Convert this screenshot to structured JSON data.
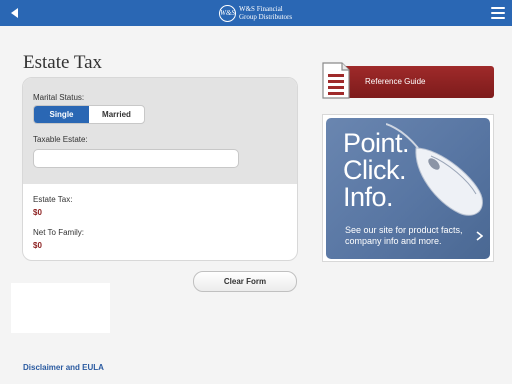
{
  "header": {
    "brand_mark": "W&S",
    "brand_line1": "W&S Financial",
    "brand_line2": "Group Distributors"
  },
  "page": {
    "title": "Estate Tax"
  },
  "form": {
    "marital_status_label": "Marital Status:",
    "marital_options": [
      "Single",
      "Married"
    ],
    "selected_marital": "Single",
    "taxable_estate_label": "Taxable Estate:",
    "taxable_estate_value": "",
    "estate_tax_label": "Estate Tax:",
    "estate_tax_value": "$0",
    "net_to_family_label": "Net To Family:",
    "net_to_family_value": "$0"
  },
  "actions": {
    "clear_label": "Clear Form"
  },
  "footer": {
    "disclaimer_label": "Disclaimer and EULA"
  },
  "sidebar": {
    "reference_guide_label": "Reference Guide",
    "promo_line1": "Point.",
    "promo_line2": "Click.",
    "promo_line3": "Info.",
    "promo_sub": "See our site for product facts, company info and more."
  },
  "colors": {
    "header_bg": "#2a67b4",
    "accent_red": "#8b1e1e",
    "link_blue": "#2a5aa0"
  },
  "icons": [
    "back-icon",
    "menu-icon",
    "document-icon",
    "chevron-right-icon",
    "mouse-image"
  ]
}
